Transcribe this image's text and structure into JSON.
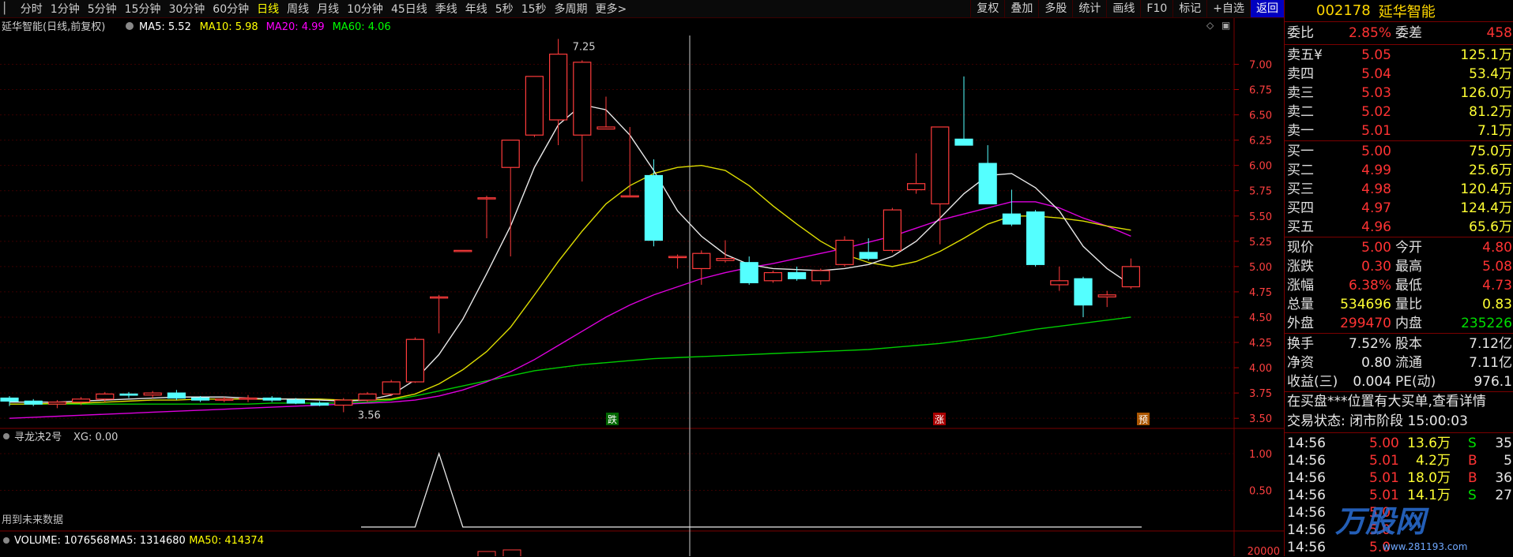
{
  "toolbar": {
    "periods": [
      "分时",
      "1分钟",
      "5分钟",
      "15分钟",
      "30分钟",
      "60分钟",
      "日线",
      "周线",
      "月线",
      "10分钟",
      "45日线",
      "季线",
      "年线",
      "5秒",
      "15秒",
      "多周期",
      "更多>"
    ],
    "active": "日线",
    "right_buttons": [
      "复权",
      "叠加",
      "多股",
      "统计",
      "画线",
      "F10",
      "标记",
      "+自选",
      "返回"
    ]
  },
  "main": {
    "title": "延华智能(日线,前复权)",
    "ma_labels": [
      {
        "text": "MA5: 5.52",
        "color": "#ffffff"
      },
      {
        "text": "MA10: 5.98",
        "color": "#ffff00"
      },
      {
        "text": "MA20: 4.99",
        "color": "#ff00ff"
      },
      {
        "text": "MA60: 4.06",
        "color": "#00ff00"
      }
    ],
    "y_ticks": [
      "7.00",
      "6.75",
      "6.50",
      "6.25",
      "6.00",
      "5.75",
      "5.50",
      "5.25",
      "5.00",
      "4.75",
      "4.50",
      "4.25",
      "4.00",
      "3.75",
      "3.50"
    ],
    "high_label": "7.25",
    "low_label": "3.56",
    "markers": [
      {
        "text": "跌",
        "bg": "#006600"
      },
      {
        "text": "涨",
        "bg": "#aa0000"
      },
      {
        "text": "预",
        "bg": "#aa5500"
      }
    ]
  },
  "indicator": {
    "title": "寻龙决2号",
    "xg_label": "XG: 0.00",
    "y_ticks": [
      "1.00",
      "0.50"
    ],
    "note": "用到未来数据"
  },
  "volume": {
    "labels": [
      {
        "text": "VOLUME: 1076568",
        "color": "#ffffff"
      },
      {
        "text": "MA5: 1314680",
        "color": "#ffffff"
      },
      {
        "text": "MA50: 414374",
        "color": "#ffff00"
      }
    ],
    "y_tick": "20000"
  },
  "chart_data": {
    "type": "candlestick",
    "ohlc": [
      [
        3.7,
        3.72,
        3.62,
        3.67
      ],
      [
        3.67,
        3.69,
        3.62,
        3.64
      ],
      [
        3.64,
        3.68,
        3.6,
        3.66
      ],
      [
        3.66,
        3.71,
        3.63,
        3.69
      ],
      [
        3.69,
        3.76,
        3.66,
        3.74
      ],
      [
        3.74,
        3.76,
        3.7,
        3.73
      ],
      [
        3.73,
        3.77,
        3.7,
        3.75
      ],
      [
        3.75,
        3.78,
        3.68,
        3.7
      ],
      [
        3.7,
        3.72,
        3.66,
        3.68
      ],
      [
        3.68,
        3.71,
        3.66,
        3.69
      ],
      [
        3.69,
        3.73,
        3.66,
        3.7
      ],
      [
        3.7,
        3.72,
        3.66,
        3.68
      ],
      [
        3.68,
        3.7,
        3.64,
        3.65
      ],
      [
        3.65,
        3.67,
        3.62,
        3.63
      ],
      [
        3.63,
        3.7,
        3.56,
        3.68
      ],
      [
        3.68,
        3.76,
        3.66,
        3.74
      ],
      [
        3.74,
        3.88,
        3.72,
        3.86
      ],
      [
        3.86,
        4.3,
        3.85,
        4.28
      ],
      [
        4.7,
        4.72,
        4.34,
        4.7
      ],
      [
        5.16,
        5.16,
        5.16,
        5.16
      ],
      [
        5.68,
        5.7,
        5.28,
        5.68
      ],
      [
        5.98,
        6.25,
        5.1,
        6.25
      ],
      [
        6.3,
        6.88,
        6.28,
        6.88
      ],
      [
        6.45,
        7.25,
        6.2,
        7.1
      ],
      [
        6.3,
        7.04,
        5.84,
        7.02
      ],
      [
        6.36,
        6.68,
        6.36,
        6.38
      ],
      [
        5.7,
        6.38,
        5.7,
        5.7
      ],
      [
        5.9,
        6.06,
        5.2,
        5.26
      ],
      [
        5.1,
        5.12,
        4.98,
        5.1
      ],
      [
        4.98,
        5.16,
        4.82,
        5.13
      ],
      [
        5.06,
        5.26,
        5.04,
        5.08
      ],
      [
        5.04,
        5.1,
        4.82,
        4.84
      ],
      [
        4.86,
        4.96,
        4.84,
        4.94
      ],
      [
        4.94,
        5.0,
        4.86,
        4.88
      ],
      [
        4.86,
        4.98,
        4.82,
        4.96
      ],
      [
        5.02,
        5.3,
        5.0,
        5.26
      ],
      [
        5.14,
        5.28,
        5.06,
        5.08
      ],
      [
        5.16,
        5.58,
        5.14,
        5.56
      ],
      [
        5.76,
        6.12,
        5.72,
        5.82
      ],
      [
        5.62,
        6.38,
        5.22,
        6.38
      ],
      [
        6.26,
        6.88,
        6.26,
        6.2
      ],
      [
        6.02,
        6.2,
        5.62,
        5.62
      ],
      [
        5.52,
        5.76,
        5.4,
        5.42
      ],
      [
        5.54,
        5.56,
        5.0,
        5.02
      ],
      [
        4.82,
        5.0,
        4.76,
        4.86
      ],
      [
        4.88,
        4.9,
        4.5,
        4.62
      ],
      [
        4.7,
        4.76,
        4.6,
        4.72
      ],
      [
        4.8,
        5.08,
        4.78,
        5.0
      ]
    ],
    "ma5": [
      3.66,
      3.66,
      3.66,
      3.67,
      3.68,
      3.69,
      3.7,
      3.71,
      3.71,
      3.71,
      3.7,
      3.69,
      3.69,
      3.68,
      3.67,
      3.68,
      3.73,
      3.88,
      4.13,
      4.48,
      4.93,
      5.4,
      5.98,
      6.4,
      6.6,
      6.55,
      6.3,
      5.95,
      5.55,
      5.3,
      5.12,
      5.02,
      4.98,
      4.97,
      4.96,
      4.98,
      5.02,
      5.1,
      5.25,
      5.48,
      5.72,
      5.9,
      5.92,
      5.78,
      5.55,
      5.2,
      4.98,
      4.82
    ],
    "ma10": [
      3.64,
      3.64,
      3.65,
      3.65,
      3.66,
      3.67,
      3.68,
      3.68,
      3.69,
      3.69,
      3.69,
      3.69,
      3.69,
      3.69,
      3.68,
      3.68,
      3.69,
      3.74,
      3.84,
      3.98,
      4.16,
      4.4,
      4.72,
      5.05,
      5.35,
      5.62,
      5.8,
      5.92,
      5.98,
      6.0,
      5.95,
      5.8,
      5.6,
      5.42,
      5.25,
      5.12,
      5.04,
      5.0,
      5.05,
      5.15,
      5.28,
      5.42,
      5.5,
      5.5,
      5.48,
      5.45,
      5.4,
      5.36
    ],
    "ma20": [
      3.5,
      3.51,
      3.52,
      3.53,
      3.54,
      3.55,
      3.56,
      3.57,
      3.58,
      3.59,
      3.6,
      3.61,
      3.62,
      3.63,
      3.64,
      3.65,
      3.66,
      3.68,
      3.72,
      3.78,
      3.86,
      3.96,
      4.08,
      4.22,
      4.36,
      4.5,
      4.62,
      4.72,
      4.8,
      4.88,
      4.94,
      4.99,
      5.03,
      5.08,
      5.13,
      5.18,
      5.24,
      5.3,
      5.38,
      5.46,
      5.52,
      5.58,
      5.64,
      5.64,
      5.58,
      5.48,
      5.4,
      5.3
    ],
    "ma60": [
      3.64,
      3.64,
      3.64,
      3.64,
      3.64,
      3.64,
      3.64,
      3.64,
      3.64,
      3.64,
      3.64,
      3.65,
      3.65,
      3.65,
      3.65,
      3.66,
      3.68,
      3.72,
      3.77,
      3.82,
      3.87,
      3.92,
      3.97,
      4.0,
      4.03,
      4.05,
      4.07,
      4.09,
      4.1,
      4.11,
      4.12,
      4.13,
      4.14,
      4.15,
      4.16,
      4.17,
      4.18,
      4.2,
      4.22,
      4.24,
      4.27,
      4.3,
      4.34,
      4.38,
      4.41,
      4.44,
      4.47,
      4.5
    ],
    "ylim": [
      3.4,
      7.3
    ],
    "indicator_xg": [
      0,
      0,
      0,
      0,
      0,
      0,
      0,
      0,
      0,
      0,
      0,
      0,
      0,
      0,
      0,
      0,
      0,
      0,
      1,
      0,
      0,
      0,
      0,
      0,
      0,
      0,
      0,
      0,
      0,
      0,
      0,
      0,
      0,
      0,
      0,
      0,
      0,
      0,
      0,
      0,
      0,
      0,
      0,
      0,
      0,
      0,
      0,
      0
    ],
    "indicator_ylim": [
      0,
      1.15
    ]
  },
  "side": {
    "code": "002178",
    "name": "延华智能",
    "weibi": {
      "label": "委比",
      "value": "2.85%",
      "label2": "委差",
      "value2": "458"
    },
    "sells": [
      {
        "label": "卖五",
        "icon": "¥",
        "price": "5.05",
        "vol": "125.1万"
      },
      {
        "label": "卖四",
        "price": "5.04",
        "vol": "53.4万"
      },
      {
        "label": "卖三",
        "price": "5.03",
        "vol": "126.0万"
      },
      {
        "label": "卖二",
        "price": "5.02",
        "vol": "81.2万"
      },
      {
        "label": "卖一",
        "price": "5.01",
        "vol": "7.1万"
      }
    ],
    "buys": [
      {
        "label": "买一",
        "price": "5.00",
        "vol": "75.0万"
      },
      {
        "label": "买二",
        "price": "4.99",
        "vol": "25.6万"
      },
      {
        "label": "买三",
        "price": "4.98",
        "vol": "120.4万"
      },
      {
        "label": "买四",
        "price": "4.97",
        "vol": "124.4万"
      },
      {
        "label": "买五",
        "price": "4.96",
        "vol": "65.6万"
      }
    ],
    "stats1": [
      {
        "l1": "现价",
        "v1": "5.00",
        "c1": "red",
        "l2": "今开",
        "v2": "4.80",
        "c2": "red"
      },
      {
        "l1": "涨跌",
        "v1": "0.30",
        "c1": "red",
        "l2": "最高",
        "v2": "5.08",
        "c2": "red"
      },
      {
        "l1": "涨幅",
        "v1": "6.38%",
        "c1": "red",
        "l2": "最低",
        "v2": "4.73",
        "c2": "red"
      },
      {
        "l1": "总量",
        "v1": "534696",
        "c1": "yellow",
        "l2": "量比",
        "v2": "0.83",
        "c2": "yellow"
      },
      {
        "l1": "外盘",
        "v1": "299470",
        "c1": "red",
        "l2": "内盘",
        "v2": "235226",
        "c2": "green"
      }
    ],
    "stats2": [
      {
        "l1": "换手",
        "v1": "7.52%",
        "c1": "white",
        "l2": "股本",
        "v2": "7.12亿",
        "c2": "white"
      },
      {
        "l1": "净资",
        "v1": "0.80",
        "c1": "white",
        "l2": "流通",
        "v2": "7.11亿",
        "c2": "white"
      },
      {
        "l1": "收益(三)",
        "v1": "0.004",
        "c1": "white",
        "l2": "PE(动)",
        "v2": "976.1",
        "c2": "white"
      }
    ],
    "notice": "在买盘***位置有大买单,查看详情",
    "trade_status": "交易状态: 闭市阶段 15:00:03",
    "ticks": [
      {
        "t": "14:56",
        "p": "5.00",
        "v": "13.6万",
        "bs": "S",
        "n": "35"
      },
      {
        "t": "14:56",
        "p": "5.01",
        "v": "4.2万",
        "bs": "B",
        "n": "5"
      },
      {
        "t": "14:56",
        "p": "5.01",
        "v": "18.0万",
        "bs": "B",
        "n": "36"
      },
      {
        "t": "14:56",
        "p": "5.01",
        "v": "14.1万",
        "bs": "S",
        "n": "27"
      },
      {
        "t": "14:56",
        "p": "5.0",
        "v": "",
        "bs": "",
        "n": ""
      },
      {
        "t": "14:56",
        "p": "5.0",
        "v": "",
        "bs": "",
        "n": ""
      },
      {
        "t": "14:56",
        "p": "5.0",
        "v": "",
        "bs": "",
        "n": ""
      }
    ],
    "watermark": "万股网",
    "watermark_url": "www.281193.com"
  }
}
